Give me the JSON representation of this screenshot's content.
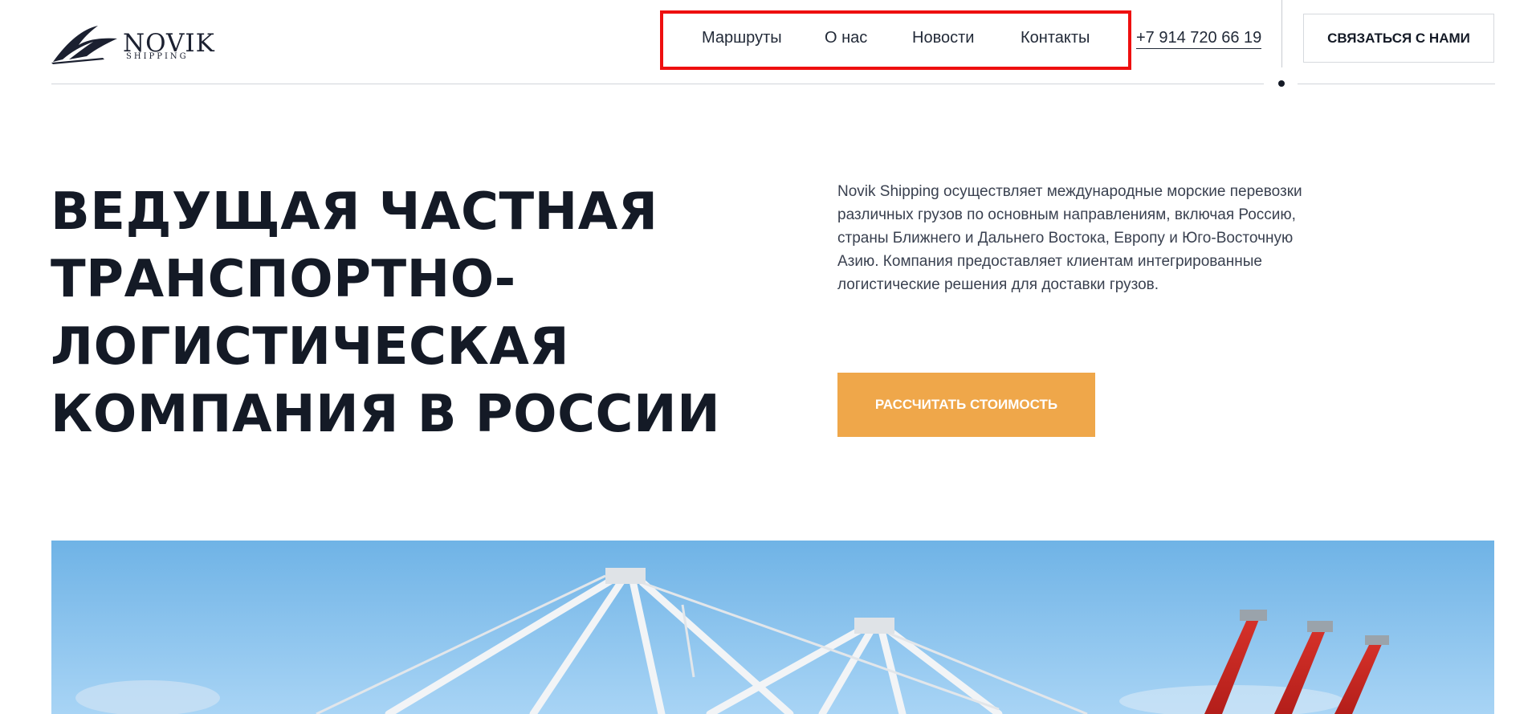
{
  "logo": {
    "name": "NOVIK",
    "subtitle": "SHIPPING"
  },
  "nav": {
    "items": [
      "Маршруты",
      "О нас",
      "Новости",
      "Контакты"
    ]
  },
  "header": {
    "phone": "+7 914 720 66 19",
    "contact_button": "СВЯЗАТЬСЯ С НАМИ"
  },
  "hero": {
    "title": "ВЕДУЩАЯ ЧАСТНАЯ ТРАНСПОРТНО-ЛОГИСТИЧЕСКАЯ КОМПАНИЯ В РОССИИ",
    "description": "Novik Shipping осуществляет международные морские перевозки различных грузов по основным направлениям, включая Россию, страны Ближнего и Дальнего Востока, Европу и Юго-Восточную Азию. Компания предоставляет клиентам интегрированные логистические решения для доставки грузов.",
    "cta": "РАССЧИТАТЬ СТОИМОСТЬ"
  },
  "colors": {
    "accent": "#efa74a",
    "text": "#141a26",
    "highlight": "#ee0f0f",
    "sky": "#7fbbe8"
  }
}
